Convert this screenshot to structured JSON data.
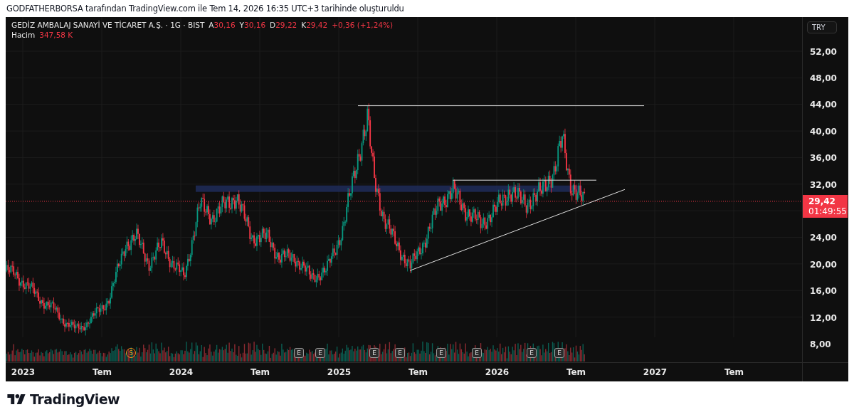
{
  "caption": "GODFATHERBORSA tarafından TradingView.com ile Tem 14, 2026 16:35 UTC+3 tarihinde oluşturuldu",
  "legend": {
    "symbol": "GEDİZ AMBALAJ SANAYİ VE TİCARET A.Ş. · 1G · BIST",
    "ohlc": [
      {
        "label": "A",
        "value": "30,16"
      },
      {
        "label": "Y",
        "value": "30,16"
      },
      {
        "label": "D",
        "value": "29,22"
      },
      {
        "label": "K",
        "value": "29,42"
      }
    ],
    "change": "+0,36 (+1,24%)",
    "volume_label": "Hacim",
    "volume_value": "347,58 K"
  },
  "currency": "TRY",
  "price_axis": [
    "52,00",
    "48,00",
    "44,00",
    "40,00",
    "36,00",
    "32,00",
    "24,00",
    "20,00",
    "16,00",
    "12,00",
    "8,00"
  ],
  "last_price": {
    "price": "29,42",
    "countdown": "01:49:55"
  },
  "time_axis": [
    "2023",
    "Tem",
    "2024",
    "Tem",
    "2025",
    "Tem",
    "2026",
    "Tem",
    "2027",
    "Tem"
  ],
  "events": [
    {
      "kind": "split",
      "label": "S"
    },
    {
      "kind": "earnings",
      "label": "E"
    },
    {
      "kind": "earnings",
      "label": "E"
    },
    {
      "kind": "earnings",
      "label": "E"
    },
    {
      "kind": "earnings",
      "label": "E"
    },
    {
      "kind": "earnings",
      "label": "E"
    },
    {
      "kind": "earnings",
      "label": "E"
    },
    {
      "kind": "earnings",
      "label": "E"
    },
    {
      "kind": "earnings",
      "label": "E"
    }
  ],
  "brand": "TradingView"
}
